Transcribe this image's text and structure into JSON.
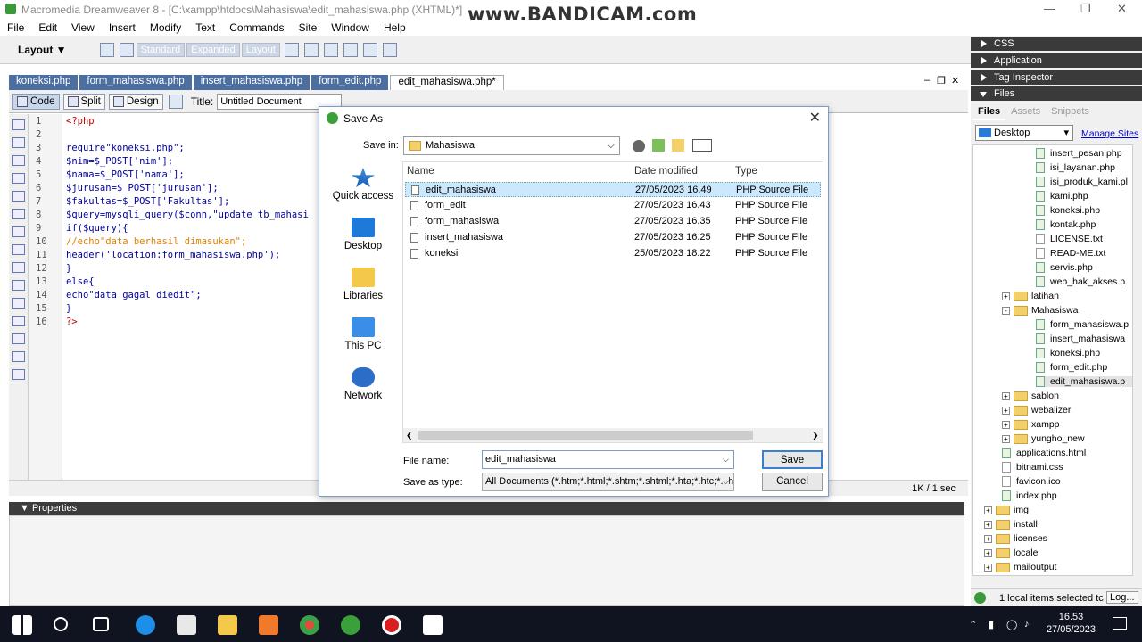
{
  "window": {
    "title": "Macromedia Dreamweaver 8 - [C:\\xampp\\htdocs\\Mahasiswa\\edit_mahasiswa.php (XHTML)*]",
    "watermark": "www.BANDICAM.com"
  },
  "menu": [
    "File",
    "Edit",
    "View",
    "Insert",
    "Modify",
    "Text",
    "Commands",
    "Site",
    "Window",
    "Help"
  ],
  "toolbar": {
    "layout_label": "Layout",
    "modes": [
      "Standard",
      "Expanded",
      "Layout"
    ]
  },
  "tabs": [
    {
      "label": "koneksi.php"
    },
    {
      "label": "form_mahasiswa.php"
    },
    {
      "label": "insert_mahasiswa.php"
    },
    {
      "label": "form_edit.php"
    },
    {
      "label": "edit_mahasiswa.php*"
    }
  ],
  "doc_toolbar": {
    "code": "Code",
    "split": "Split",
    "design": "Design",
    "title_label": "Title:",
    "title_value": "Untitled Document"
  },
  "code_lines": [
    {
      "n": "1",
      "text": "<?php",
      "color": "#c00000"
    },
    {
      "n": "2",
      "text": "",
      "color": "#000"
    },
    {
      "n": "3",
      "text": "require\"koneksi.php\";",
      "color": "#0000a0"
    },
    {
      "n": "4",
      "text": "$nim=$_POST['nim'];",
      "color": "#0000a0"
    },
    {
      "n": "5",
      "text": "$nama=$_POST['nama'];",
      "color": "#0000a0"
    },
    {
      "n": "6",
      "text": "$jurusan=$_POST['jurusan'];",
      "color": "#0000a0"
    },
    {
      "n": "7",
      "text": "$fakultas=$_POST['Fakultas'];",
      "color": "#0000a0"
    },
    {
      "n": "8",
      "text": "$query=mysqli_query($conn,\"update tb_mahasi",
      "color": "#0000a0"
    },
    {
      "n": "9",
      "text": "if($query){",
      "color": "#0000a0"
    },
    {
      "n": "10",
      "text": "//echo\"data berhasil dimasukan\";",
      "color": "#e08000"
    },
    {
      "n": "11",
      "text": "header('location:form_mahasiswa.php');",
      "color": "#0000a0"
    },
    {
      "n": "12",
      "text": "}",
      "color": "#0000a0"
    },
    {
      "n": "13",
      "text": "else{",
      "color": "#0000a0"
    },
    {
      "n": "14",
      "text": "echo\"data gagal diedit\";",
      "color": "#0000a0"
    },
    {
      "n": "15",
      "text": "}",
      "color": "#0000a0"
    },
    {
      "n": "16",
      "text": "?>",
      "color": "#c00000"
    }
  ],
  "status": {
    "size": "1K / 1 sec"
  },
  "properties": {
    "label": "Properties"
  },
  "right_panels": {
    "css": "CSS",
    "application": "Application",
    "tag_inspector": "Tag Inspector",
    "files": "Files"
  },
  "files_panel": {
    "tabs": [
      "Files",
      "Assets",
      "Snippets"
    ],
    "site": "Desktop",
    "manage": "Manage Sites",
    "items": [
      {
        "name": "insert_pesan.php",
        "kind": "php",
        "level": 3
      },
      {
        "name": "isi_layanan.php",
        "kind": "php",
        "level": 3
      },
      {
        "name": "isi_produk_kami.pl",
        "kind": "php",
        "level": 3
      },
      {
        "name": "kami.php",
        "kind": "php",
        "level": 3
      },
      {
        "name": "koneksi.php",
        "kind": "php",
        "level": 3
      },
      {
        "name": "kontak.php",
        "kind": "php",
        "level": 3
      },
      {
        "name": "LICENSE.txt",
        "kind": "txt",
        "level": 3
      },
      {
        "name": "READ-ME.txt",
        "kind": "txt",
        "level": 3
      },
      {
        "name": "servis.php",
        "kind": "php",
        "level": 3
      },
      {
        "name": "web_hak_akses.p",
        "kind": "php",
        "level": 3
      },
      {
        "name": "latihan",
        "kind": "folder",
        "level": 2,
        "exp": "+"
      },
      {
        "name": "Mahasiswa",
        "kind": "folder",
        "level": 2,
        "exp": "-"
      },
      {
        "name": "form_mahasiswa.p",
        "kind": "php",
        "level": 3
      },
      {
        "name": "insert_mahasiswa",
        "kind": "php",
        "level": 3
      },
      {
        "name": "koneksi.php",
        "kind": "php",
        "level": 3
      },
      {
        "name": "form_edit.php",
        "kind": "php",
        "level": 3
      },
      {
        "name": "edit_mahasiswa.p",
        "kind": "php",
        "level": 3,
        "sel": true
      },
      {
        "name": "sablon",
        "kind": "folder",
        "level": 2,
        "exp": "+"
      },
      {
        "name": "webalizer",
        "kind": "folder",
        "level": 2,
        "exp": "+"
      },
      {
        "name": "xampp",
        "kind": "folder",
        "level": 2,
        "exp": "+"
      },
      {
        "name": "yungho_new",
        "kind": "folder",
        "level": 2,
        "exp": "+"
      },
      {
        "name": "applications.html",
        "kind": "php",
        "level": 2
      },
      {
        "name": "bitnami.css",
        "kind": "txt",
        "level": 2
      },
      {
        "name": "favicon.ico",
        "kind": "ico",
        "level": 2
      },
      {
        "name": "index.php",
        "kind": "php",
        "level": 2
      },
      {
        "name": "img",
        "kind": "folder",
        "level": 1,
        "exp": "+"
      },
      {
        "name": "install",
        "kind": "folder",
        "level": 1,
        "exp": "+"
      },
      {
        "name": "licenses",
        "kind": "folder",
        "level": 1,
        "exp": "+"
      },
      {
        "name": "locale",
        "kind": "folder",
        "level": 1,
        "exp": "+"
      },
      {
        "name": "mailoutput",
        "kind": "folder",
        "level": 1,
        "exp": "+"
      }
    ],
    "status": "1 local items selected tc",
    "log": "Log..."
  },
  "dialog": {
    "title": "Save As",
    "save_in_label": "Save in:",
    "save_in_value": "Mahasiswa",
    "places": [
      "Quick access",
      "Desktop",
      "Libraries",
      "This PC",
      "Network"
    ],
    "columns": [
      "Name",
      "Date modified",
      "Type"
    ],
    "files": [
      {
        "name": "edit_mahasiswa",
        "date": "27/05/2023 16.49",
        "type": "PHP Source File"
      },
      {
        "name": "form_edit",
        "date": "27/05/2023 16.43",
        "type": "PHP Source File"
      },
      {
        "name": "form_mahasiswa",
        "date": "27/05/2023 16.35",
        "type": "PHP Source File"
      },
      {
        "name": "insert_mahasiswa",
        "date": "27/05/2023 16.25",
        "type": "PHP Source File"
      },
      {
        "name": "koneksi",
        "date": "25/05/2023 18.22",
        "type": "PHP Source File"
      }
    ],
    "file_name_label": "File name:",
    "file_name_value": "edit_mahasiswa",
    "type_label": "Save as type:",
    "type_value": "All Documents (*.htm;*.html;*.shtm;*.shtml;*.hta;*.htc;*.xhtml",
    "save": "Save",
    "cancel": "Cancel"
  },
  "taskbar": {
    "time": "16.53",
    "date": "27/05/2023"
  }
}
